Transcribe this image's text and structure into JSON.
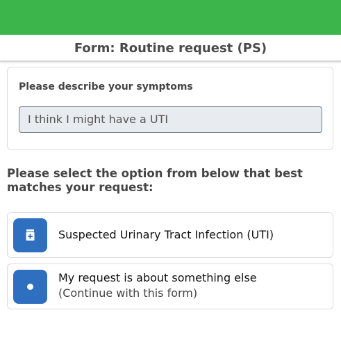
{
  "header": {
    "title": "Form: Routine request (PS)"
  },
  "symptoms": {
    "label": "Please describe your symptoms",
    "value": "I think I might have a UTI"
  },
  "prompt": "Please select the option from below that best matches your request:",
  "options": [
    {
      "title": "Suspected Urinary Tract Infection (UTI)",
      "icon": "medicine-bottle-icon"
    },
    {
      "title": "My request is about something else",
      "subtitle": "(Continue with this form)",
      "icon": "dot-icon"
    }
  ],
  "colors": {
    "header_bar": "#3cb54a",
    "icon_bg": "#2f6fbf"
  }
}
